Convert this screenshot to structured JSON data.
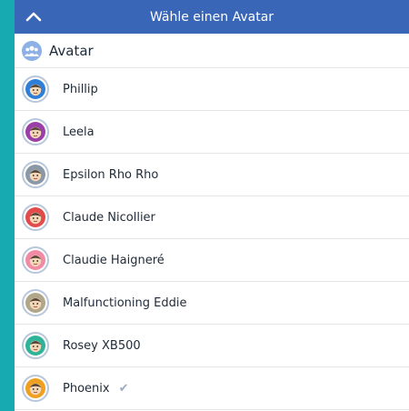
{
  "header": {
    "title": "Wähle einen Avatar"
  },
  "section": {
    "label": "Avatar",
    "icon": "group-icon"
  },
  "avatars": [
    {
      "name": "Phillip",
      "icon": "boy-avatar-icon",
      "color": "#2f7fd6",
      "selected": false
    },
    {
      "name": "Leela",
      "icon": "girl-avatar-icon",
      "color": "#9b3fa8",
      "selected": false
    },
    {
      "name": "Epsilon Rho Rho",
      "icon": "robot-avatar-icon",
      "color": "#8a98a8",
      "selected": false
    },
    {
      "name": "Claude Nicollier",
      "icon": "astronaut-avatar-icon",
      "color": "#e24b4b",
      "selected": false
    },
    {
      "name": "Claudie Haigneré",
      "icon": "astronaut-avatar-icon",
      "color": "#f08aa5",
      "selected": false
    },
    {
      "name": "Malfunctioning Eddie",
      "icon": "robot-avatar-icon",
      "color": "#b0a78a",
      "selected": false
    },
    {
      "name": "Rosey XB500",
      "icon": "robot-avatar-icon",
      "color": "#2fb49a",
      "selected": false
    },
    {
      "name": "Phoenix",
      "icon": "firefighter-avatar-icon",
      "color": "#f0a020",
      "selected": true
    }
  ],
  "check_mark": "✔",
  "colors": {
    "header": "#3a66b8",
    "background": "#17aab0"
  }
}
